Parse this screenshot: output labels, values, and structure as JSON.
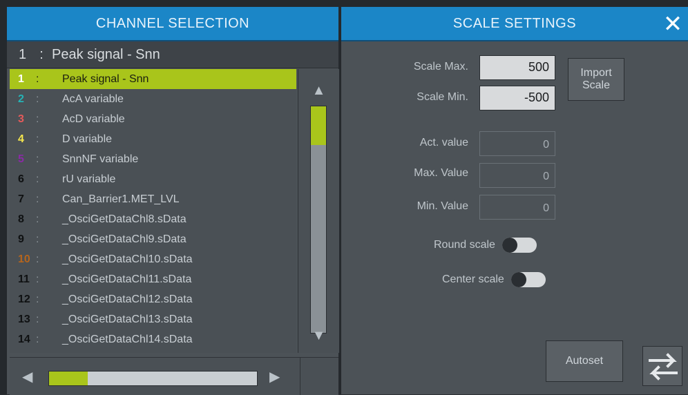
{
  "left_panel": {
    "title": "CHANNEL SELECTION",
    "selected": {
      "number": "1",
      "separator": ":",
      "name": "Peak signal - Snn"
    },
    "channels": [
      {
        "number": "1",
        "separator": ":",
        "name": "Peak signal - Snn",
        "color": "#ffffff",
        "active": true
      },
      {
        "number": "2",
        "separator": ":",
        "name": "AcA variable",
        "color": "#25b3b6"
      },
      {
        "number": "3",
        "separator": ":",
        "name": "AcD variable",
        "color": "#e55a5a"
      },
      {
        "number": "4",
        "separator": ":",
        "name": "D variable",
        "color": "#f5e64e"
      },
      {
        "number": "5",
        "separator": ":",
        "name": "SnnNF variable",
        "color": "#8a2aa6"
      },
      {
        "number": "6",
        "separator": ":",
        "name": "rU variable",
        "color": "#0f1112"
      },
      {
        "number": "7",
        "separator": ":",
        "name": "Can_Barrier1.MET_LVL",
        "color": "#0f1112"
      },
      {
        "number": "8",
        "separator": ":",
        "name": "_OsciGetDataChl8.sData",
        "color": "#0f1112"
      },
      {
        "number": "9",
        "separator": ":",
        "name": "_OsciGetDataChl9.sData",
        "color": "#0f1112"
      },
      {
        "number": "10",
        "separator": ":",
        "name": "_OsciGetDataChl10.sData",
        "color": "#b5651d"
      },
      {
        "number": "11",
        "separator": ":",
        "name": "_OsciGetDataChl11.sData",
        "color": "#0f1112"
      },
      {
        "number": "12",
        "separator": ":",
        "name": "_OsciGetDataChl12.sData",
        "color": "#0f1112"
      },
      {
        "number": "13",
        "separator": ":",
        "name": "_OsciGetDataChl13.sData",
        "color": "#0f1112"
      },
      {
        "number": "14",
        "separator": ":",
        "name": "_OsciGetDataChl14.sData",
        "color": "#0f1112"
      }
    ],
    "scroll_up": "▲",
    "scroll_down": "▼",
    "scroll_left": "◀",
    "scroll_right": "▶"
  },
  "right_panel": {
    "title": "SCALE SETTINGS",
    "close_glyph": "✕",
    "scale_max_label": "Scale Max.",
    "scale_max_value": "500",
    "scale_min_label": "Scale Min.",
    "scale_min_value": "-500",
    "import_scale": "Import\nScale",
    "act_value_label": "Act. value",
    "act_value": "0",
    "max_value_label": "Max. Value",
    "max_value": "0",
    "min_value_label": "Min. Value",
    "min_value": "0",
    "round_scale_label": "Round scale",
    "center_scale_label": "Center scale",
    "autoset": "Autoset"
  },
  "colors": {
    "header_bg": "#1b86c7",
    "accent_green": "#a9c51b",
    "panel_bg": "#4c5257"
  }
}
